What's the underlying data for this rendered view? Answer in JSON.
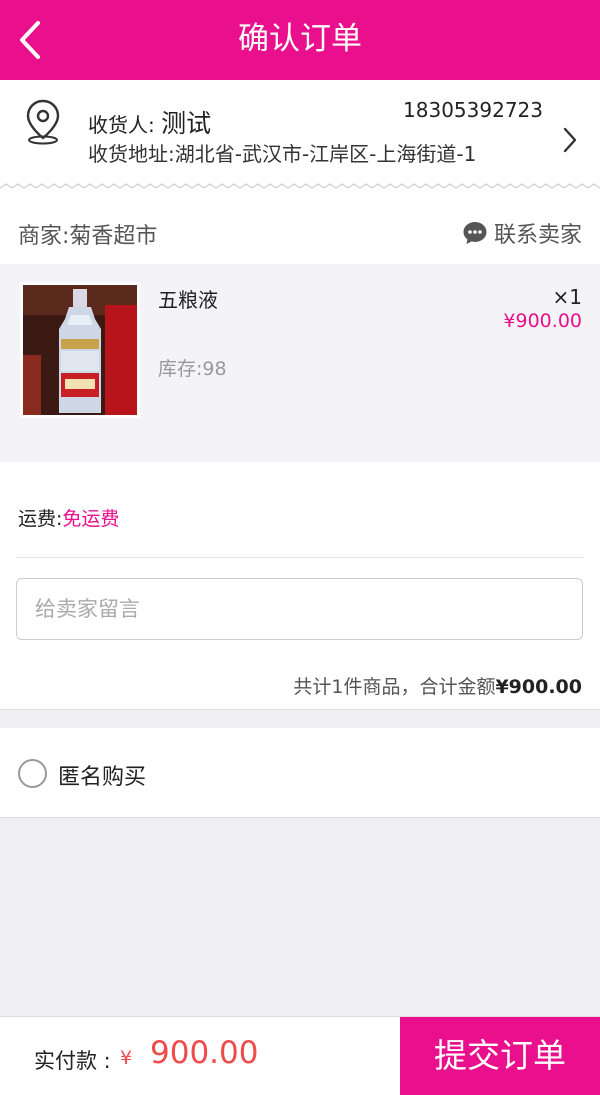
{
  "header": {
    "title": "确认订单",
    "back_icon": "chevron-left-icon"
  },
  "address": {
    "receiver_label": "收货人:",
    "receiver_name": "测试",
    "phone": "18305392723",
    "address_text": "收货地址:湖北省-武汉市-江岸区-上海街道-1",
    "pin_icon": "location-pin-icon",
    "chevron_icon": "chevron-right-icon"
  },
  "shop": {
    "name": "商家:菊香超市",
    "contact_label": "联系卖家",
    "contact_icon": "chat-bubble-icon"
  },
  "item": {
    "name": "五粮液",
    "quantity": "×1",
    "price": "¥900.00",
    "stock": "库存:98"
  },
  "order": {
    "shipping_label": "运费:",
    "shipping_value": "免运费",
    "message_placeholder": "给卖家留言",
    "message_value": "",
    "total_prefix": "共计1件商品，合计金额",
    "total_amount": "¥900.00"
  },
  "anonymous": {
    "label": "匿名购买",
    "checked": false
  },
  "footer": {
    "pay_label": "实付款 :",
    "currency": "¥",
    "amount": "900.00",
    "submit_label": "提交订单"
  },
  "colors": {
    "brand": "#ea0f8c",
    "price_red": "#f04b4b"
  }
}
